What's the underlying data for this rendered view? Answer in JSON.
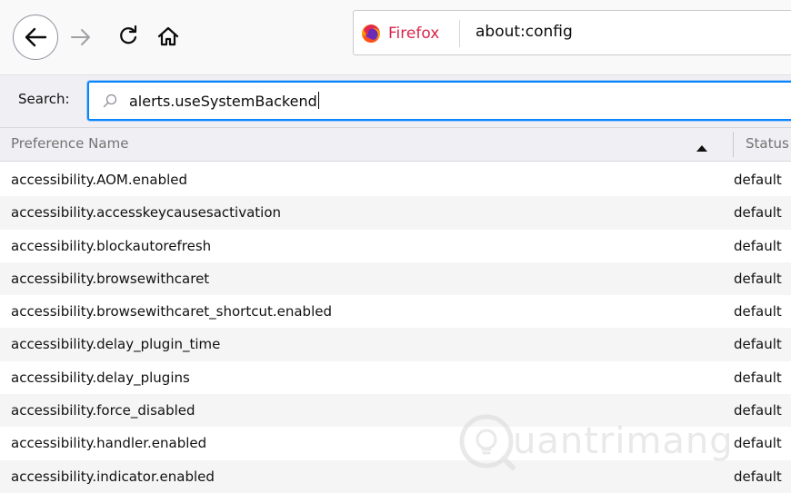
{
  "toolbar": {
    "identity_label": "Firefox",
    "url": "about:config"
  },
  "search": {
    "label": "Search:",
    "value": "alerts.useSystemBackend"
  },
  "table": {
    "columns": {
      "name": "Preference Name",
      "status": "Status"
    },
    "rows": [
      {
        "name": "accessibility.AOM.enabled",
        "status": "default"
      },
      {
        "name": "accessibility.accesskeycausesactivation",
        "status": "default"
      },
      {
        "name": "accessibility.blockautorefresh",
        "status": "default"
      },
      {
        "name": "accessibility.browsewithcaret",
        "status": "default"
      },
      {
        "name": "accessibility.browsewithcaret_shortcut.enabled",
        "status": "default"
      },
      {
        "name": "accessibility.delay_plugin_time",
        "status": "default"
      },
      {
        "name": "accessibility.delay_plugins",
        "status": "default"
      },
      {
        "name": "accessibility.force_disabled",
        "status": "default"
      },
      {
        "name": "accessibility.handler.enabled",
        "status": "default"
      },
      {
        "name": "accessibility.indicator.enabled",
        "status": "default"
      }
    ]
  },
  "watermark": {
    "text": "uantrimang"
  },
  "icons": {
    "back": "back-arrow-icon",
    "forward": "forward-arrow-icon",
    "reload": "reload-icon",
    "home": "home-icon",
    "identity": "firefox-logo-icon",
    "search": "search-icon",
    "sort": "sort-ascending-icon"
  },
  "colors": {
    "accent": "#0a84ff",
    "identity": "#d7264c"
  }
}
